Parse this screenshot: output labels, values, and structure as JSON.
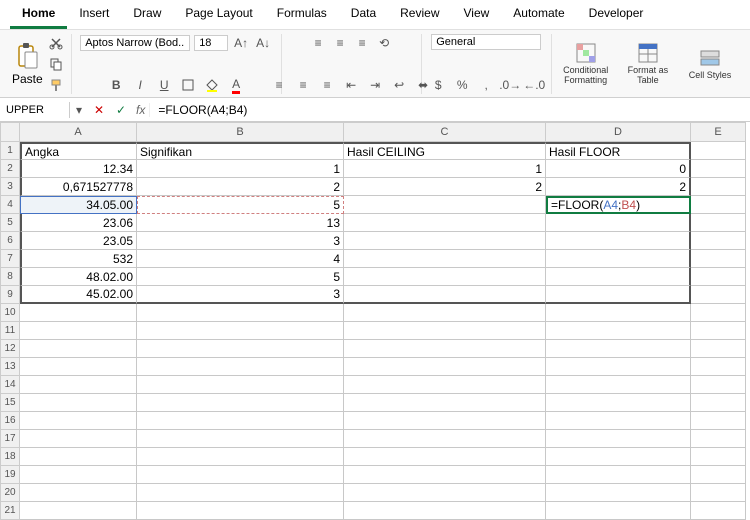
{
  "tabs": [
    "Home",
    "Insert",
    "Draw",
    "Page Layout",
    "Formulas",
    "Data",
    "Review",
    "View",
    "Automate",
    "Developer"
  ],
  "activeTab": 0,
  "paste_label": "Paste",
  "font_name": "Aptos Narrow (Bod...",
  "font_size": "18",
  "number_format": "General",
  "cond_fmt": "Conditional Formatting",
  "fmt_table": "Format as Table",
  "cell_styles": "Cell Styles",
  "namebox": "UPPER",
  "formula_text": "=FLOOR(A4;B4)",
  "columns": [
    "A",
    "B",
    "C",
    "D",
    "E"
  ],
  "headers": {
    "A": "Angka",
    "B": "Signifikan",
    "C": "Hasil CEILING",
    "D": "Hasil FLOOR"
  },
  "data": {
    "A": [
      "12.34",
      "0,671527778",
      "34.05.00",
      "23.06",
      "23.05",
      "532",
      "48.02.00",
      "45.02.00"
    ],
    "B": [
      "1",
      "2",
      "5",
      "13",
      "3",
      "4",
      "5",
      "3"
    ],
    "C": [
      "1",
      "2"
    ],
    "D": [
      "0",
      "2"
    ]
  },
  "edit": {
    "prefix": "=FLOOR(",
    "ref1": "A4",
    "sep": ";",
    "ref2": "B4",
    "suffix": ")"
  }
}
